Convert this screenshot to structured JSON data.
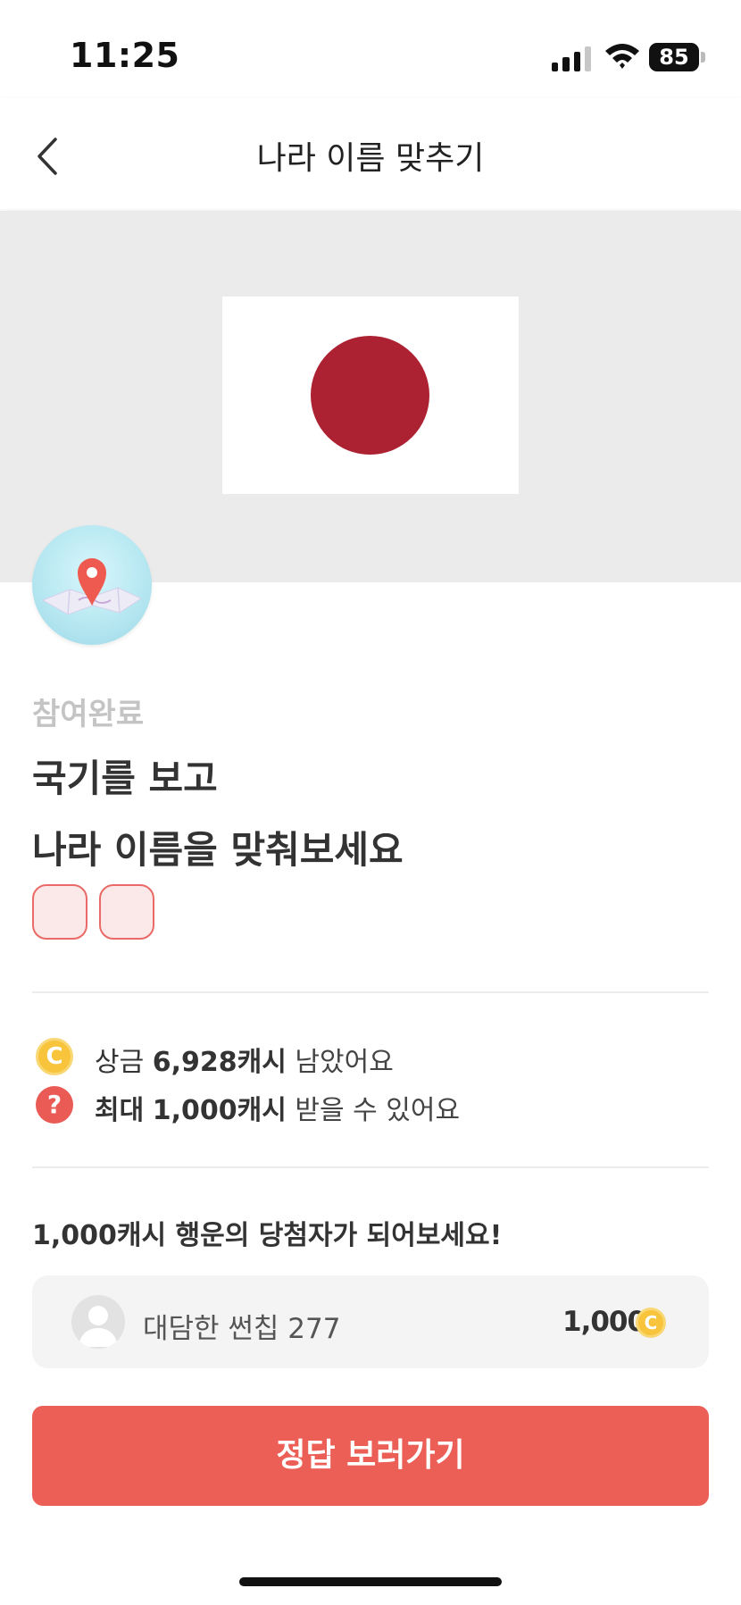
{
  "status_bar": {
    "time": "11:25",
    "battery": "85"
  },
  "header": {
    "title": "나라 이름 맞추기"
  },
  "quiz": {
    "status": "참여완료",
    "question_line1": "국기를 보고",
    "question_line2": "나라 이름을 맞춰보세요",
    "answer_boxes": 2
  },
  "info": {
    "prize_prefix": "상금",
    "prize_amount": "6,928캐시",
    "prize_suffix": "남았어요",
    "max_prefix": "최대",
    "max_amount": "1,000캐시",
    "max_suffix": "받을 수 있어요",
    "coin_symbol": "C",
    "help_symbol": "?"
  },
  "winners": {
    "title": "1,000캐시 행운의 당첨자가 되어보세요!",
    "items": [
      {
        "name": "대담한 썬칩 277",
        "amount": "1,000"
      }
    ]
  },
  "cta": {
    "label": "정답 보러가기"
  },
  "colors": {
    "accent": "#eb5f57",
    "flag_red": "#ad2232",
    "coin": "#f7c43b"
  }
}
